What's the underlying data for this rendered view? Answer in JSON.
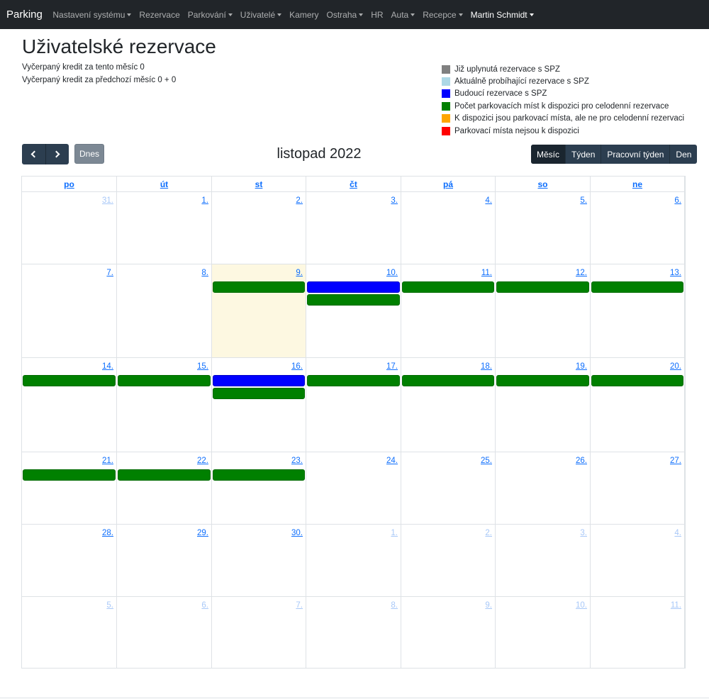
{
  "navbar": {
    "brand": "Parking",
    "items": [
      {
        "label": "Nastavení systému",
        "dropdown": true
      },
      {
        "label": "Rezervace",
        "dropdown": false
      },
      {
        "label": "Parkování",
        "dropdown": true
      },
      {
        "label": "Uživatelé",
        "dropdown": true
      },
      {
        "label": "Kamery",
        "dropdown": false
      },
      {
        "label": "Ostraha",
        "dropdown": true
      },
      {
        "label": "HR",
        "dropdown": false
      },
      {
        "label": "Auta",
        "dropdown": true
      },
      {
        "label": "Recepce",
        "dropdown": true
      }
    ],
    "user": "Martin Schmidt"
  },
  "page": {
    "title": "Uživatelské rezervace",
    "credit_this_month": "Vyčerpaný kredit za tento měsíc 0",
    "credit_prev_month": "Vyčerpaný kredit za předchozí měsíc 0 + 0"
  },
  "legend": [
    {
      "color": "#808080",
      "label": "Již uplynutá rezervace s SPZ"
    },
    {
      "color": "#add8e6",
      "label": "Aktuálně probíhající rezervace s SPZ"
    },
    {
      "color": "#0000ff",
      "label": "Budoucí rezervace s SPZ"
    },
    {
      "color": "#008000",
      "label": "Počet parkovacích míst k dispozici pro celodenní rezervace"
    },
    {
      "color": "#ffa500",
      "label": "K dispozici jsou parkovací místa, ale ne pro celodenní rezervaci"
    },
    {
      "color": "#ff0000",
      "label": "Parkovací místa nejsou k dispozici"
    }
  ],
  "toolbar": {
    "prev_icon": "chevron-left-icon",
    "next_icon": "chevron-right-icon",
    "today_label": "Dnes",
    "title": "listopad 2022",
    "views": [
      {
        "label": "Měsíc",
        "active": true
      },
      {
        "label": "Týden",
        "active": false
      },
      {
        "label": "Pracovní týden",
        "active": false
      },
      {
        "label": "Den",
        "active": false
      }
    ]
  },
  "calendar": {
    "weekdays": [
      "po",
      "út",
      "st",
      "čt",
      "pá",
      "so",
      "ne"
    ],
    "today": "9.",
    "weeks": [
      [
        {
          "label": "31.",
          "other": true,
          "events": []
        },
        {
          "label": "1.",
          "other": false,
          "events": []
        },
        {
          "label": "2.",
          "other": false,
          "events": []
        },
        {
          "label": "3.",
          "other": false,
          "events": []
        },
        {
          "label": "4.",
          "other": false,
          "events": []
        },
        {
          "label": "5.",
          "other": false,
          "events": []
        },
        {
          "label": "6.",
          "other": false,
          "events": []
        }
      ],
      [
        {
          "label": "7.",
          "other": false,
          "events": []
        },
        {
          "label": "8.",
          "other": false,
          "events": []
        },
        {
          "label": "9.",
          "other": false,
          "today": true,
          "events": [
            "green"
          ]
        },
        {
          "label": "10.",
          "other": false,
          "events": [
            "blue",
            "green"
          ]
        },
        {
          "label": "11.",
          "other": false,
          "events": [
            "green"
          ]
        },
        {
          "label": "12.",
          "other": false,
          "events": [
            "green"
          ]
        },
        {
          "label": "13.",
          "other": false,
          "events": [
            "green"
          ]
        }
      ],
      [
        {
          "label": "14.",
          "other": false,
          "events": [
            "green"
          ]
        },
        {
          "label": "15.",
          "other": false,
          "events": [
            "green"
          ]
        },
        {
          "label": "16.",
          "other": false,
          "events": [
            "blue",
            "green"
          ]
        },
        {
          "label": "17.",
          "other": false,
          "events": [
            "green"
          ]
        },
        {
          "label": "18.",
          "other": false,
          "events": [
            "green"
          ]
        },
        {
          "label": "19.",
          "other": false,
          "events": [
            "green"
          ]
        },
        {
          "label": "20.",
          "other": false,
          "events": [
            "green"
          ]
        }
      ],
      [
        {
          "label": "21.",
          "other": false,
          "events": [
            "green"
          ]
        },
        {
          "label": "22.",
          "other": false,
          "events": [
            "green"
          ]
        },
        {
          "label": "23.",
          "other": false,
          "events": [
            "green"
          ]
        },
        {
          "label": "24.",
          "other": false,
          "events": []
        },
        {
          "label": "25.",
          "other": false,
          "events": []
        },
        {
          "label": "26.",
          "other": false,
          "events": []
        },
        {
          "label": "27.",
          "other": false,
          "events": []
        }
      ],
      [
        {
          "label": "28.",
          "other": false,
          "events": []
        },
        {
          "label": "29.",
          "other": false,
          "events": []
        },
        {
          "label": "30.",
          "other": false,
          "events": []
        },
        {
          "label": "1.",
          "other": true,
          "events": []
        },
        {
          "label": "2.",
          "other": true,
          "events": []
        },
        {
          "label": "3.",
          "other": true,
          "events": []
        },
        {
          "label": "4.",
          "other": true,
          "events": []
        }
      ],
      [
        {
          "label": "5.",
          "other": true,
          "events": []
        },
        {
          "label": "6.",
          "other": true,
          "events": []
        },
        {
          "label": "7.",
          "other": true,
          "events": []
        },
        {
          "label": "8.",
          "other": true,
          "events": []
        },
        {
          "label": "9.",
          "other": true,
          "events": []
        },
        {
          "label": "10.",
          "other": true,
          "events": []
        },
        {
          "label": "11.",
          "other": true,
          "events": []
        }
      ]
    ]
  }
}
